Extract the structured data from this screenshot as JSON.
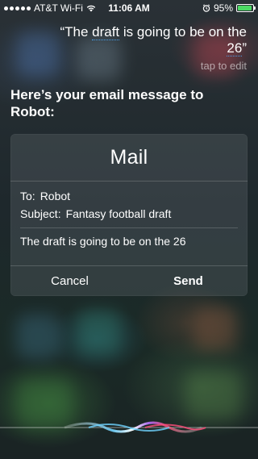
{
  "status_bar": {
    "carrier": "AT&T Wi-Fi",
    "time": "11:06 AM",
    "battery_percent": "95%",
    "battery_level": 0.95,
    "battery_color": "#4cd964"
  },
  "siri": {
    "spoken_text": "“The draft is going to be on the 26”",
    "spoken_text_parts": {
      "open_quote": "“The ",
      "draft": "draft",
      "mid": " is going to be on the ",
      "num": "26",
      "close_quote": "”"
    },
    "tap_to_edit": "tap to edit",
    "prompt": "Here’s your email message to Robot:"
  },
  "mail_card": {
    "title": "Mail",
    "to_label": "To:",
    "to_value": "Robot",
    "subject_label": "Subject:",
    "subject_value": "Fantasy football draft",
    "body": "The draft is going to be on the 26",
    "cancel_label": "Cancel",
    "send_label": "Send"
  },
  "icons": [
    "wifi-icon",
    "alarm-icon",
    "battery-icon",
    "siri-waveform-icon"
  ]
}
